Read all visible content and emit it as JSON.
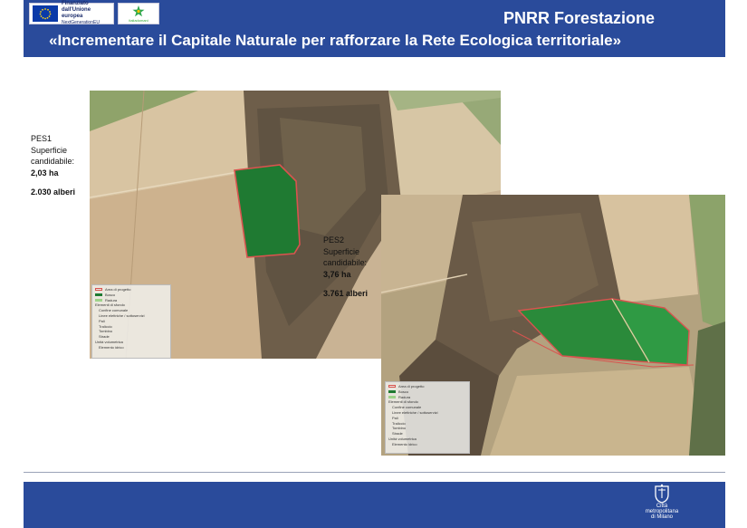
{
  "header": {
    "title": "PNRR Forestazione",
    "subtitle": "«Incrementare il Capitale Naturale per rafforzare la Rete Ecologica territoriale»",
    "eu_logo": {
      "line1": "Finanziato",
      "line2": "dall'Unione europea",
      "line3": "NextGenerationEU",
      "icon": "eu-flag-icon"
    },
    "italia_logo": {
      "tag": "italiadomani",
      "icon": "star-icon"
    }
  },
  "sites": [
    {
      "name": "PES1",
      "label": "Superficie candidabile:",
      "area": "2,03 ha",
      "trees": "2.030 alberi"
    },
    {
      "name": "PES2",
      "label": "Superficie candidabile:",
      "area": "3,76 ha",
      "trees": "3.761 alberi"
    }
  ],
  "legend": {
    "items": [
      {
        "label": "Area di progetto",
        "color": "#d9534f"
      },
      {
        "label": "Bosco",
        "color": "#1f7a32"
      },
      {
        "label": "Radura",
        "color": "#9ed38a"
      }
    ],
    "section": "Elementi di sfondo",
    "background_items": [
      "Confine comunale",
      "Linee elettriche / sottoservizi",
      "Pali",
      "Traliccio",
      "Tombino",
      "Strade",
      "Unità volumetrica",
      "Elemento idrico"
    ]
  },
  "footer": {
    "logo_line1": "Città",
    "logo_line2": "metropolitana",
    "logo_line3": "di Milano",
    "icon": "crest-icon"
  },
  "colors": {
    "brand_blue": "#2a4b9b",
    "forest_green": "#1f7a32",
    "project_outline": "#d9534f"
  }
}
